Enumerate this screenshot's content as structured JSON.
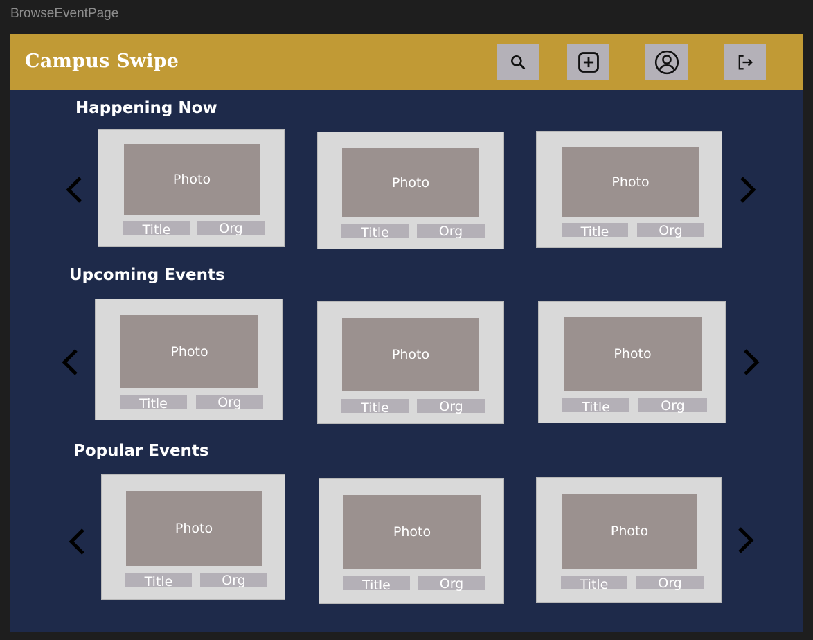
{
  "frame_label": "BrowseEventPage",
  "header": {
    "app_title": "Campus Swipe",
    "icons": [
      "search-icon",
      "plus-square-icon",
      "user-circle-icon",
      "logout-icon"
    ]
  },
  "sections": [
    {
      "title": "Happening Now",
      "cards": [
        {
          "photo": "Photo",
          "title": "Title",
          "org": "Org"
        },
        {
          "photo": "Photo",
          "title": "Title",
          "org": "Org"
        },
        {
          "photo": "Photo",
          "title": "Title",
          "org": "Org"
        }
      ]
    },
    {
      "title": "Upcoming Events",
      "cards": [
        {
          "photo": "Photo",
          "title": "Title",
          "org": "Org"
        },
        {
          "photo": "Photo",
          "title": "Title",
          "org": "Org"
        },
        {
          "photo": "Photo",
          "title": "Title",
          "org": "Org"
        }
      ]
    },
    {
      "title": "Popular Events",
      "cards": [
        {
          "photo": "Photo",
          "title": "Title",
          "org": "Org"
        },
        {
          "photo": "Photo",
          "title": "Title",
          "org": "Org"
        },
        {
          "photo": "Photo",
          "title": "Title",
          "org": "Org"
        }
      ]
    }
  ],
  "colors": {
    "header_bg": "#c19a35",
    "page_bg": "#1e2a4a",
    "card_bg": "#d9d9d9",
    "photo_bg": "#9b918f",
    "pill_bg": "#b4b0b7"
  }
}
